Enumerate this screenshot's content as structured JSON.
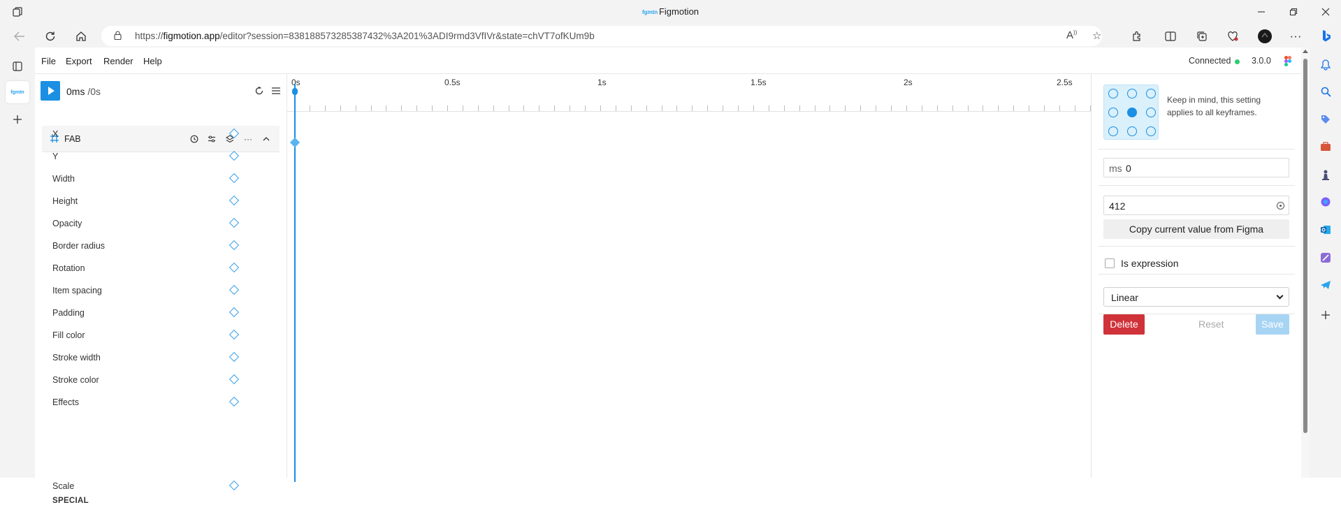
{
  "browser": {
    "window_title": "Figmotion",
    "url_prefix": "https://",
    "url_host": "figmotion.app",
    "url_rest": "/editor?session=838188573285387432%3A201%3ADI9rmd3VfIVr&state=chVT7ofKUm9b",
    "tab_favicon_text": "fgmtn"
  },
  "menu": {
    "items": [
      "File",
      "Export",
      "Render",
      "Help"
    ],
    "connection_status": "Connected",
    "connection_color": "#2ecc71",
    "version": "3.0.0"
  },
  "player": {
    "current_time": "0ms",
    "total_time": "/0s",
    "accent_color": "#1a8fe3"
  },
  "layer": {
    "name": "FAB",
    "properties": [
      "X",
      "Y",
      "Width",
      "Height",
      "Opacity",
      "Border radius",
      "Rotation",
      "Item spacing",
      "Padding",
      "Fill color",
      "Stroke width",
      "Stroke color",
      "Effects"
    ],
    "special_header": "SPECIAL",
    "special_properties": [
      "Scale"
    ]
  },
  "timeline": {
    "ticks": [
      "0s",
      "0.5s",
      "1s",
      "1.5s",
      "2s",
      "2.5s"
    ]
  },
  "editor": {
    "note": "Keep in mind, this setting applies to all keyframes.",
    "time_prefix": "ms",
    "time_value": "0",
    "value": "412",
    "copy_button": "Copy current value from Figma",
    "expression_label": "Is expression",
    "expression_checked": false,
    "easing": "Linear",
    "delete_button": "Delete",
    "reset_button": "Reset",
    "save_button": "Save",
    "delete_color": "#d0323a",
    "save_color": "#a8d4f4"
  }
}
